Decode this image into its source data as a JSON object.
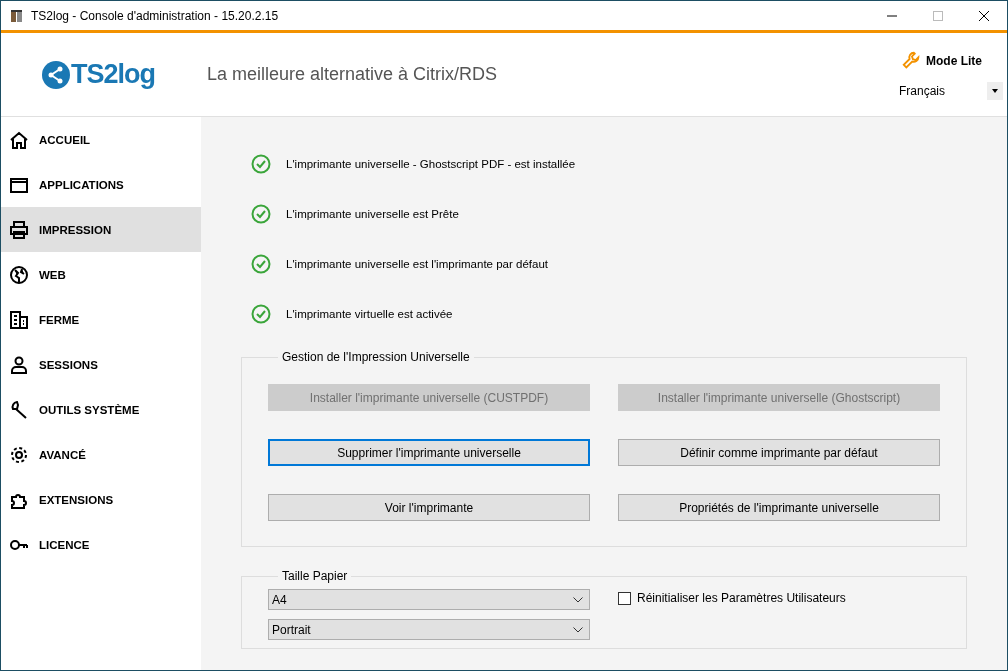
{
  "window": {
    "title": "TS2log - Console d'administration - 15.20.2.15"
  },
  "header": {
    "logo": "TS2log",
    "tagline": "La meilleure alternative à Citrix/RDS",
    "mode_button": "Mode Lite",
    "language": "Français"
  },
  "sidebar": {
    "items": [
      {
        "label": "ACCUEIL",
        "selected": false
      },
      {
        "label": "APPLICATIONS",
        "selected": false
      },
      {
        "label": "IMPRESSION",
        "selected": true
      },
      {
        "label": "WEB",
        "selected": false
      },
      {
        "label": "FERME",
        "selected": false
      },
      {
        "label": "SESSIONS",
        "selected": false
      },
      {
        "label": "OUTILS SYSTÈME",
        "selected": false
      },
      {
        "label": "AVANCÉ",
        "selected": false
      },
      {
        "label": "EXTENSIONS",
        "selected": false
      },
      {
        "label": "LICENCE",
        "selected": false
      }
    ]
  },
  "status": [
    {
      "text": "L'imprimante universelle - Ghostscript PDF - est installée",
      "ok": true
    },
    {
      "text": "L'imprimante universelle est Prête",
      "ok": true
    },
    {
      "text": "L'imprimante universelle est l'imprimante par défaut",
      "ok": true
    },
    {
      "text": "L'imprimante virtuelle est activée",
      "ok": true
    }
  ],
  "management": {
    "title": "Gestion de l'Impression Universelle",
    "buttons": [
      {
        "label": "Installer l'imprimante universelle (CUSTPDF)",
        "disabled": true,
        "focused": false
      },
      {
        "label": "Installer l'imprimante universelle (Ghostscript)",
        "disabled": true,
        "focused": false
      },
      {
        "label": "Supprimer l'imprimante universelle",
        "disabled": false,
        "focused": true
      },
      {
        "label": "Définir comme imprimante par défaut",
        "disabled": false,
        "focused": false
      },
      {
        "label": "Voir l'imprimante",
        "disabled": false,
        "focused": false
      },
      {
        "label": "Propriétés de l'imprimante universelle",
        "disabled": false,
        "focused": false
      }
    ]
  },
  "paper": {
    "title": "Taille Papier",
    "size": "A4",
    "orientation": "Portrait",
    "reset_checkbox": {
      "label": "Réinitialiser les Paramètres Utilisateurs",
      "checked": false
    }
  }
}
